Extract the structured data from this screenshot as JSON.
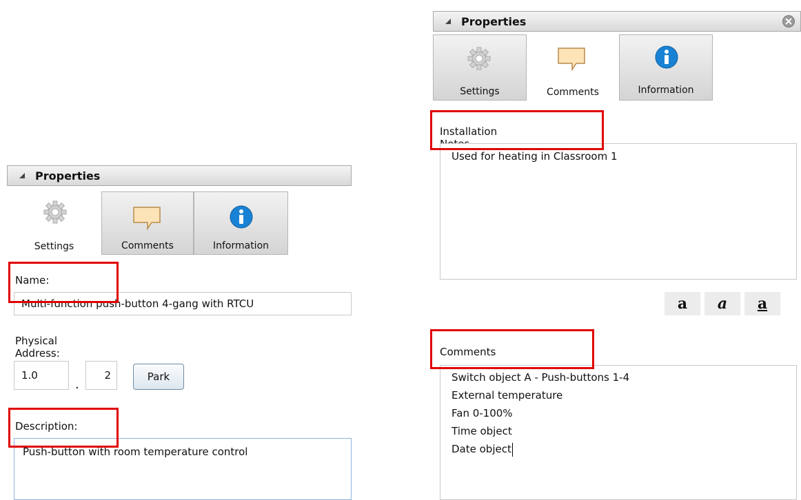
{
  "left_panel": {
    "title": "Properties",
    "tabs": [
      {
        "label": "Settings",
        "icon": "gear-icon"
      },
      {
        "label": "Comments",
        "icon": "comment-icon"
      },
      {
        "label": "Information",
        "icon": "info-icon"
      }
    ],
    "name_label": "Name:",
    "name_value": "Multi-function push-button 4-gang with RTCU",
    "address_label": "Physical Address:",
    "address_area": "1.0",
    "address_separator": ".",
    "address_device": "2",
    "park_label": "Park",
    "description_label": "Description:",
    "description_value": "Push-button with room temperature control"
  },
  "right_panel": {
    "title": "Properties",
    "tabs": [
      {
        "label": "Settings",
        "icon": "gear-icon"
      },
      {
        "label": "Comments",
        "icon": "comment-icon"
      },
      {
        "label": "Information",
        "icon": "info-icon"
      }
    ],
    "installation_notes_label": "Installation Notes",
    "installation_notes_value": "Used for heating in Classroom 1",
    "format_buttons": [
      "a",
      "a",
      "a"
    ],
    "comments_label": "Comments",
    "comments_lines": [
      "Switch object A - Push-buttons 1-4",
      "External temperature",
      "Fan 0-100%",
      "Time object",
      "Date object"
    ]
  },
  "colors": {
    "highlight": "#e00000",
    "info_blue": "#1a82d4",
    "comment_fill": "#fde3b8"
  }
}
